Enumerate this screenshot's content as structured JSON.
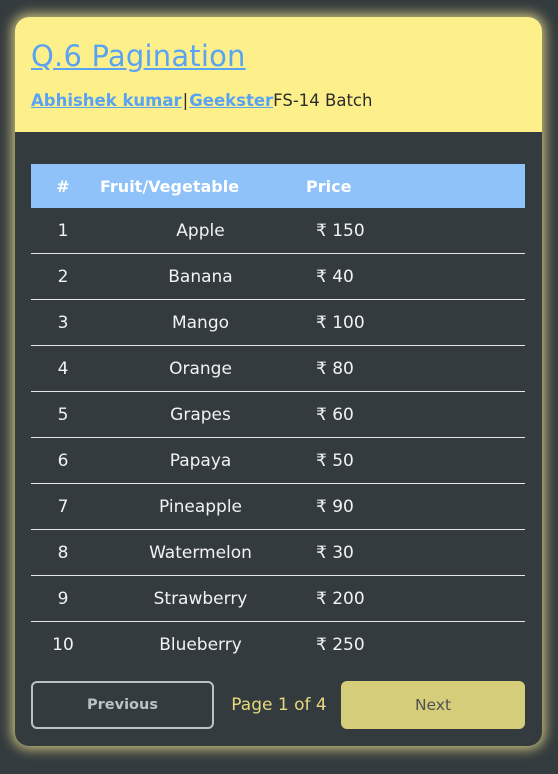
{
  "header": {
    "title": "Q.6 Pagination",
    "author_link": "Abhishek kumar",
    "separator": "|",
    "org_link": "Geekster",
    "batch": "FS-14 Batch"
  },
  "table": {
    "columns": [
      "#",
      "Fruit/Vegetable",
      "Price"
    ],
    "rows": [
      {
        "num": "1",
        "name": "Apple",
        "price": "₹ 150"
      },
      {
        "num": "2",
        "name": "Banana",
        "price": "₹ 40"
      },
      {
        "num": "3",
        "name": "Mango",
        "price": "₹ 100"
      },
      {
        "num": "4",
        "name": "Orange",
        "price": "₹ 80"
      },
      {
        "num": "5",
        "name": "Grapes",
        "price": "₹ 60"
      },
      {
        "num": "6",
        "name": "Papaya",
        "price": "₹ 50"
      },
      {
        "num": "7",
        "name": "Pineapple",
        "price": "₹ 90"
      },
      {
        "num": "8",
        "name": "Watermelon",
        "price": "₹ 30"
      },
      {
        "num": "9",
        "name": "Strawberry",
        "price": "₹ 200"
      },
      {
        "num": "10",
        "name": "Blueberry",
        "price": "₹ 250"
      }
    ]
  },
  "pagination": {
    "previous_label": "Previous",
    "page_info": "Page 1 of 4",
    "next_label": "Next"
  },
  "colors": {
    "background": "#343b3e",
    "header_bg": "#fdf08a",
    "link": "#5aa3f3",
    "table_header_bg": "#8ec2f8",
    "next_button_bg": "#d6cd7a",
    "page_info_text": "#e7d97d"
  }
}
